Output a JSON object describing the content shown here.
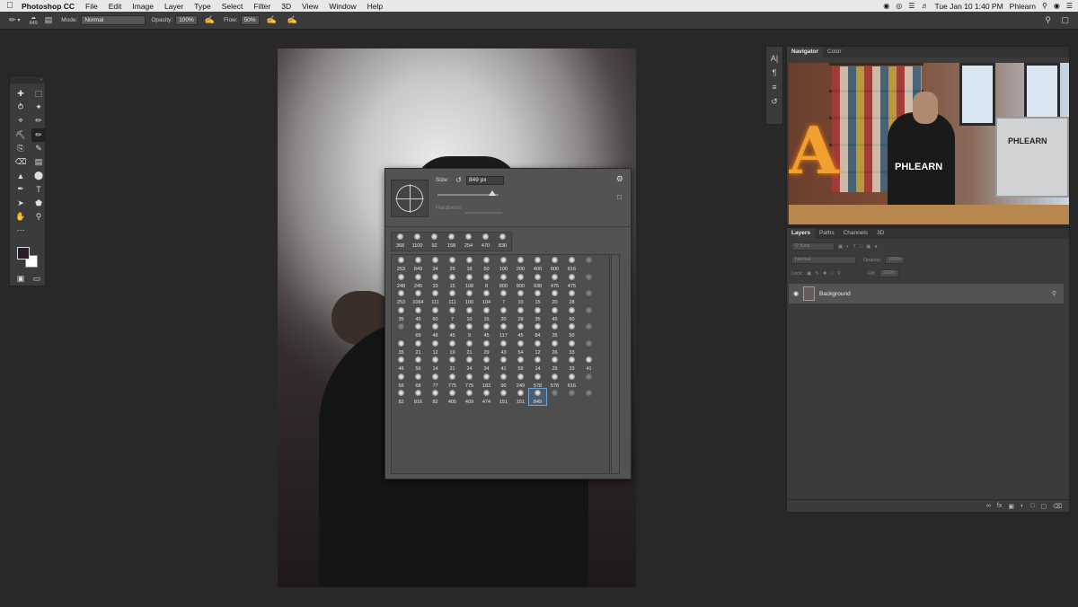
{
  "menubar": {
    "app_name": "Photoshop CC",
    "items": [
      "File",
      "Edit",
      "Image",
      "Layer",
      "Type",
      "Select",
      "Filter",
      "3D",
      "View",
      "Window",
      "Help"
    ],
    "clock": "Tue Jan 10  1:40 PM",
    "user": "Phlearn"
  },
  "options": {
    "brush_size": "849",
    "mode_label": "Mode:",
    "mode_value": "Normal",
    "opacity_label": "Opacity:",
    "opacity_value": "100%",
    "flow_label": "Flow:",
    "flow_value": "50%"
  },
  "brush_picker": {
    "size_label": "Size:",
    "size_value": "849 px",
    "size_level_fraction": 0.9,
    "hardness_label": "Hardness:",
    "recent": [
      "368",
      "1100",
      "92",
      "158",
      "254",
      "470",
      "830"
    ],
    "grid": [
      [
        "253",
        "849",
        "34",
        "29",
        "18",
        "50",
        "100",
        "200",
        "400",
        "600",
        "616",
        ""
      ],
      [
        "248",
        "245",
        "33",
        "15",
        "108",
        "8",
        "800",
        "800",
        "938",
        "475",
        "475",
        ""
      ],
      [
        "253",
        "1064",
        "111",
        "111",
        "100",
        "104",
        "7",
        "10",
        "15",
        "20",
        "28",
        ""
      ],
      [
        "35",
        "45",
        "60",
        "7",
        "10",
        "15",
        "20",
        "28",
        "35",
        "45",
        "60",
        ""
      ],
      [
        "",
        "69",
        "48",
        "45",
        "9",
        "45",
        "117",
        "45",
        "84",
        "35",
        "50",
        ""
      ],
      [
        "35",
        "21",
        "12",
        "19",
        "21",
        "29",
        "43",
        "54",
        "12",
        "26",
        "33",
        ""
      ],
      [
        "46",
        "56",
        "14",
        "21",
        "24",
        "34",
        "41",
        "59",
        "14",
        "25",
        "33",
        "41"
      ],
      [
        "56",
        "68",
        "77",
        "775",
        "775",
        "183",
        "90",
        "249",
        "578",
        "578",
        "616",
        ""
      ],
      [
        "82",
        "816",
        "82",
        "405",
        "409",
        "474",
        "151",
        "151",
        "849",
        "",
        "",
        ""
      ]
    ],
    "selected_index": [
      8,
      8
    ]
  },
  "right_panels": {
    "nav_tabs": [
      "Navigator",
      "Color"
    ],
    "layers_tabs": [
      "Layers",
      "Paths",
      "Channels",
      "3D"
    ],
    "kind_placeholder": "Kind",
    "blend_mode": "Normal",
    "opacity_label": "Opacity:",
    "opacity_value": "100%",
    "lock_label": "Lock:",
    "fill_label": "Fill:",
    "fill_value": "100%",
    "layer_name": "Background",
    "thumb_shirt_text": "PHLEARN",
    "thumb_monitor_text": "PHLEARN"
  },
  "colors": {
    "foreground": "#2a1e26",
    "background": "#ffffff",
    "panel": "#3b3b3b",
    "workspace": "#282828"
  }
}
